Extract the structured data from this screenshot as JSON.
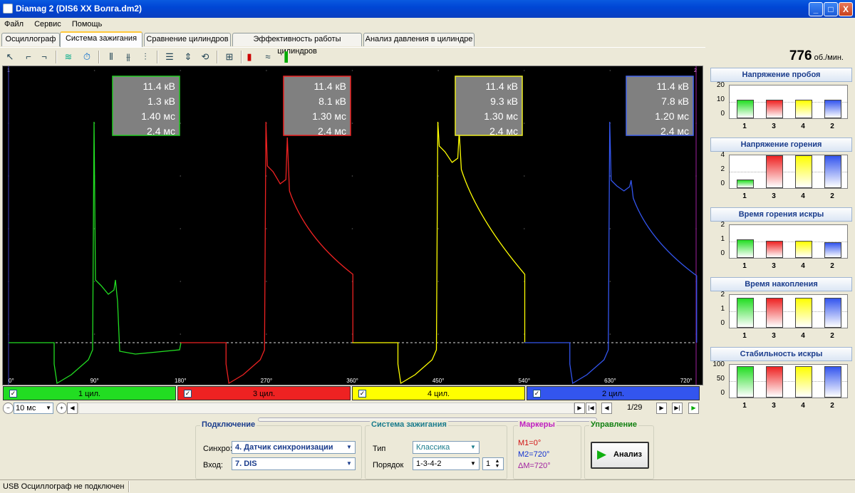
{
  "window": {
    "title": "Diamag 2 (DIS6 XX Волга.dm2)",
    "min": "_",
    "max": "□",
    "close": "X"
  },
  "menu": [
    "Файл",
    "Сервис",
    "Помощь"
  ],
  "tabs": [
    "Осциллограф",
    "Система зажигания",
    "Сравнение цилиндров",
    "Эффективность работы цилиндров",
    "Анализ давления в цилиндре"
  ],
  "rpm": {
    "value": "776",
    "unit": "об./мин."
  },
  "toolbar_icons": [
    "cursor-icon",
    "pulse-up-icon",
    "pulse-down-icon",
    "channel-icon",
    "time-counter-icon",
    "signal-a-icon",
    "signal-b-icon",
    "signal-c-icon",
    "grid-lines-icon",
    "zoom-icon",
    "overlay-icon",
    "measure-icon",
    "bars-red-icon",
    "stripes-icon",
    "bars-color-icon"
  ],
  "scope": {
    "xticks": [
      "0°",
      "90°",
      "180°",
      "270°",
      "360°",
      "450°",
      "540°",
      "630°",
      "720°"
    ],
    "markers": {
      "left": "1",
      "right": "2"
    },
    "info": [
      {
        "lines": [
          "11.4 кВ",
          "1.3 кВ",
          "1.40 мс",
          "2.4 мс"
        ],
        "color": "#22cc22"
      },
      {
        "lines": [
          "11.4 кВ",
          "8.1 кВ",
          "1.30 мс",
          "2.4 мс"
        ],
        "color": "#ee2222"
      },
      {
        "lines": [
          "11.4 кВ",
          "9.3 кВ",
          "1.30 мс",
          "2.4 мс"
        ],
        "color": "#eeee22"
      },
      {
        "lines": [
          "11.4 кВ",
          "7.8 кВ",
          "1.20 мс",
          "2.4 мс"
        ],
        "color": "#4466ee"
      }
    ]
  },
  "channels": [
    {
      "label": "1 цил.",
      "color": "#22dd22"
    },
    {
      "label": "3 цил.",
      "color": "#ee2222"
    },
    {
      "label": "4 цил.",
      "color": "#ffff00"
    },
    {
      "label": "2 цил.",
      "color": "#3355ee"
    }
  ],
  "nav": {
    "timebase": "10 мс",
    "page": "1/29"
  },
  "panels": [
    {
      "title": "Напряжение пробоя",
      "ymax": 20,
      "yticks": [
        "20",
        "10",
        "0"
      ],
      "values": [
        11.4,
        11.4,
        11.4,
        11.4
      ]
    },
    {
      "title": "Напряжение горения",
      "ymax": 5,
      "yticks": [
        "4",
        "2",
        "0"
      ],
      "values": [
        1.3,
        8.1,
        9.3,
        7.8
      ]
    },
    {
      "title": "Время горения искры",
      "ymax": 2.5,
      "yticks": [
        "2",
        "1",
        "0"
      ],
      "values": [
        1.4,
        1.3,
        1.3,
        1.2
      ]
    },
    {
      "title": "Время накопления",
      "ymax": 2.6,
      "yticks": [
        "2",
        "1",
        "0"
      ],
      "values": [
        2.4,
        2.4,
        2.4,
        2.4
      ]
    },
    {
      "title": "Стабильность искры",
      "ymax": 105,
      "yticks": [
        "100",
        "50",
        "0"
      ],
      "values": [
        100,
        100,
        100,
        100
      ]
    }
  ],
  "panel_xlabels": [
    "1",
    "3",
    "4",
    "2"
  ],
  "connection": {
    "title": "Подключение",
    "sync_label": "Синхро:",
    "sync_value": "4.  Датчик синхронизации",
    "input_label": "Вход:",
    "input_value": "7.  DIS"
  },
  "ignition": {
    "title": "Система зажигания",
    "type_label": "Тип",
    "type_value": "Классика",
    "order_label": "Порядок",
    "order_value": "1-3-4-2",
    "order_num": "1"
  },
  "markers": {
    "title": "Маркеры",
    "m1": "M1=0°",
    "m2": "M2=720°",
    "dm": "ΔM=720°"
  },
  "control": {
    "title": "Управление",
    "analyze": "Анализ"
  },
  "status": "USB Осциллограф не подключен"
}
